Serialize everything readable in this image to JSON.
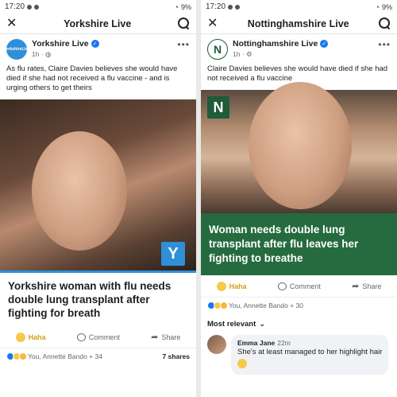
{
  "left": {
    "status": {
      "time": "17:20",
      "battery": "9%"
    },
    "topbar": {
      "title": "Yorkshire Live"
    },
    "post": {
      "page_name": "Yorkshire Live",
      "meta": "1h ·",
      "avatar_text": "YorkshireLive",
      "caption": "As flu rates, Claire Davies believes she would have died if she had not received a flu vaccine - and is urging others to get theirs",
      "badge": "Y",
      "headline": "Yorkshire woman with flu needs double lung transplant after fighting for breath"
    },
    "actions": {
      "haha": "Haha",
      "comment": "Comment",
      "share": "Share"
    },
    "reactions": {
      "people": "You, Annette Bando + 34",
      "shares": "7 shares"
    }
  },
  "right": {
    "status": {
      "time": "17:20",
      "battery": "9%"
    },
    "topbar": {
      "title": "Nottinghamshire Live"
    },
    "post": {
      "page_name": "Nottinghamshire Live",
      "meta": "1h ·",
      "avatar_text": "N",
      "caption": "Claire Davies believes she would have died if she had not received a flu vaccine",
      "badge": "N",
      "headline": "Woman needs double lung transplant after flu leaves her fighting to breathe"
    },
    "actions": {
      "haha": "Haha",
      "comment": "Comment",
      "share": "Share"
    },
    "reactions": {
      "people": "You, Annette Bando + 30"
    },
    "comments": {
      "sort_label": "Most relevant",
      "items": [
        {
          "name": "Emma Jane",
          "time": "22m",
          "text": "She's at least managed to her highlight hair"
        }
      ]
    }
  },
  "colors": {
    "yorkshire_blue": "#2f8fd8",
    "notts_green": "#256b3f",
    "fb_blue": "#1877f2"
  }
}
